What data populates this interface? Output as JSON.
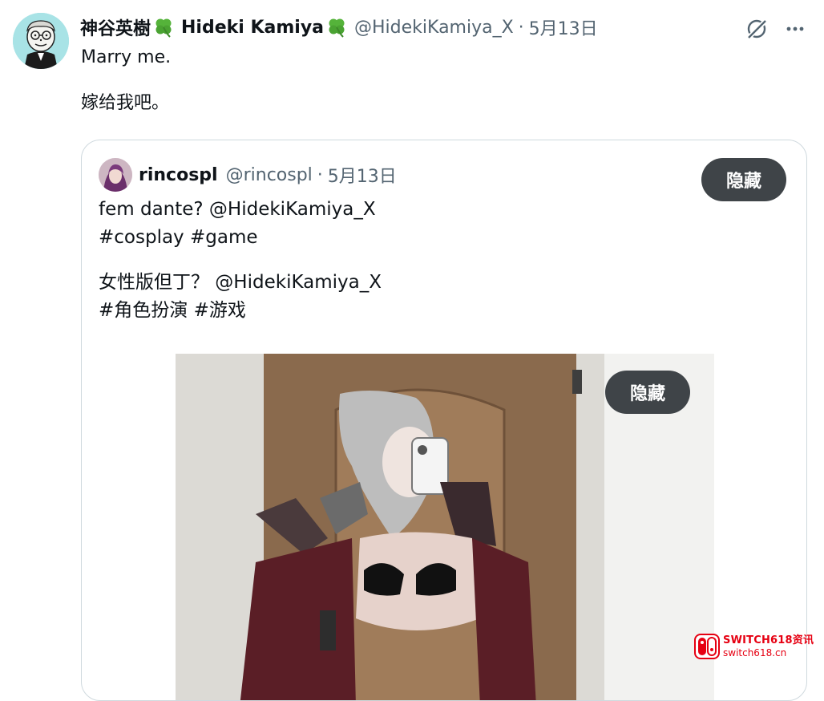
{
  "author": {
    "display_name": "神谷英樹",
    "display_name_latin": "Hideki Kamiya",
    "handle": "@HidekiKamiya_X",
    "separator": "·",
    "date": "5月13日",
    "avatar_icon": "cartoon-avatar",
    "name_emoji_icon": "four-leaf-clover-icon"
  },
  "tweet": {
    "line1": "Marry me.",
    "line2": "嫁给我吧。"
  },
  "actions": {
    "grok_icon": "grok-icon",
    "more_icon": "more-dots-icon"
  },
  "quote": {
    "display_name": "rincospl",
    "handle": "@rincospl",
    "separator": "·",
    "date": "5月13日",
    "hide_label": "隐藏",
    "text_lines": [
      "fem dante? @HidekiKamiya_X",
      "#cosplay #game",
      "女性版但丁？ @HidekiKamiya_X",
      "#角色扮演 #游戏"
    ],
    "media": {
      "hide_label": "隐藏"
    }
  },
  "watermark": {
    "line1": "SWITCH618资讯",
    "line2": "switch618.cn"
  },
  "colors": {
    "primary_text": "#0f1419",
    "secondary_text": "#536471",
    "border": "#cfd9de",
    "hide_button_bg": "#3f4448",
    "avatar_bg": "#a8e3e6",
    "watermark_red": "#e60012"
  }
}
